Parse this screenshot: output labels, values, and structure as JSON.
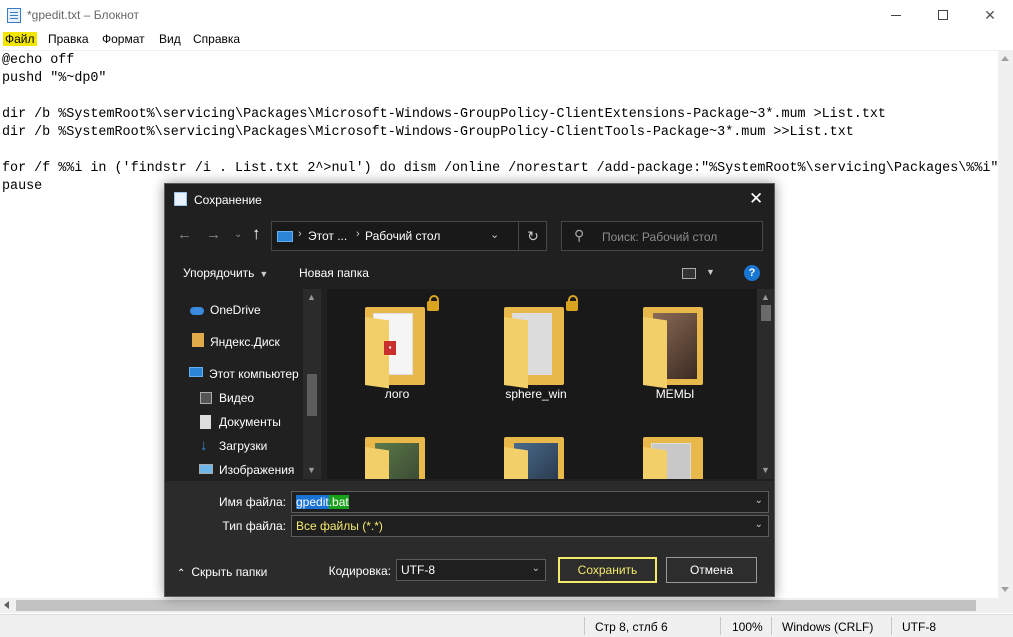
{
  "notepad": {
    "title": "*gpedit.txt – Блокнот",
    "menu": [
      "Файл",
      "Правка",
      "Формат",
      "Вид",
      "Справка"
    ],
    "lines": [
      "@echo off",
      "pushd \"%~dp0\"",
      "",
      "dir /b %SystemRoot%\\servicing\\Packages\\Microsoft-Windows-GroupPolicy-ClientExtensions-Package~3*.mum >List.txt",
      "dir /b %SystemRoot%\\servicing\\Packages\\Microsoft-Windows-GroupPolicy-ClientTools-Package~3*.mum >>List.txt",
      "",
      "for /f %%i in ('findstr /i . List.txt 2^>nul') do dism /online /norestart /add-package:\"%SystemRoot%\\servicing\\Packages\\%%i\"",
      "pause"
    ],
    "status": {
      "position": "Стр 8, стлб 6",
      "zoom": "100%",
      "line_endings": "Windows (CRLF)",
      "encoding": "UTF-8"
    }
  },
  "dialog": {
    "title": "Сохранение",
    "close_glyph": "✕",
    "breadcrumb": [
      "Этот ...",
      "Рабочий стол"
    ],
    "search_placeholder": "Поиск: Рабочий стол",
    "toolbar": {
      "organize": "Упорядочить",
      "new_folder": "Новая папка",
      "help": "?"
    },
    "nav_items": [
      "OneDrive",
      "Яндекс.Диск",
      "Этот компьютер",
      "Видео",
      "Документы",
      "Загрузки",
      "Изображения"
    ],
    "files": [
      "лого",
      "sphere_win",
      "МЕМЫ"
    ],
    "file_name_label": "Имя файла:",
    "file_name_parts": [
      "gpedit",
      ".bat"
    ],
    "file_type_label": "Тип файла:",
    "file_type_value": "Все файлы  (*.*)",
    "hide_folders": "Скрыть папки",
    "encoding_label": "Кодировка:",
    "encoding_value": "UTF-8",
    "save_button": "Сохранить",
    "cancel_button": "Отмена"
  },
  "colors": {
    "menu_highlight": "#f2e500",
    "dialog_bg": "#202020",
    "accent_yellow": "#f3e96b",
    "selection_blue": "#1a73d4",
    "selection_green": "#1aa21a"
  },
  "icons": [
    "notepad-icon",
    "pc-icon",
    "search-icon",
    "refresh-icon",
    "onedrive-icon",
    "yandex-disk-icon",
    "computer-icon",
    "video-icon",
    "documents-icon",
    "downloads-icon",
    "pictures-icon",
    "lock-icon",
    "help-icon"
  ]
}
